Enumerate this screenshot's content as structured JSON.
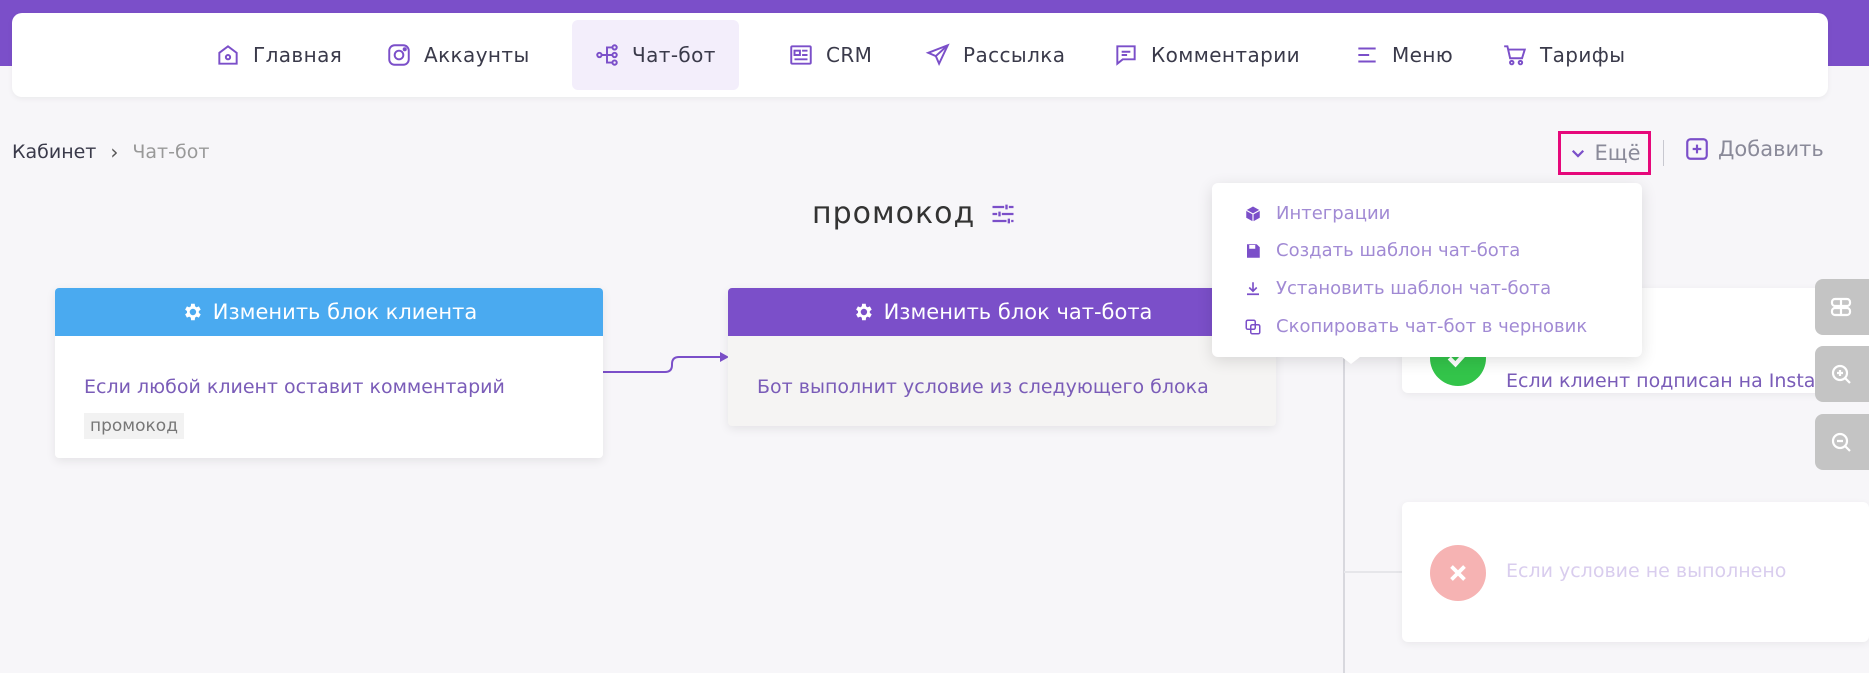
{
  "nav": {
    "items": [
      {
        "label": "Главная",
        "icon": "home-icon"
      },
      {
        "label": "Аккаунты",
        "icon": "instagram-icon"
      },
      {
        "label": "Чат-бот",
        "icon": "flow-icon"
      },
      {
        "label": "CRM",
        "icon": "crm-icon"
      },
      {
        "label": "Рассылка",
        "icon": "send-icon"
      },
      {
        "label": "Комментарии",
        "icon": "comment-icon"
      },
      {
        "label": "Меню",
        "icon": "menu-icon"
      },
      {
        "label": "Тарифы",
        "icon": "cart-icon"
      }
    ],
    "active": "Чат-бот"
  },
  "breadcrumb": {
    "root": "Кабинет",
    "current": "Чат-бот"
  },
  "toolbar": {
    "more_label": "Ещё",
    "add_label": "Добавить"
  },
  "page": {
    "title": "промокод"
  },
  "client_block": {
    "header": "Изменить блок клиента",
    "text": "Если любой клиент оставит комментарий",
    "tag": "промокод",
    "color": "#4aaaf0"
  },
  "bot_block": {
    "header": "Изменить блок чат-бота",
    "text": "Бот выполнит условие из следующего блока",
    "color": "#7b4fc9"
  },
  "conditions": {
    "yes_text": "Если клиент подписан на Instagr",
    "no_text": "Если условие не выполнено",
    "yes_color": "#33c44a",
    "no_color": "#f6b3b3"
  },
  "dropdown": {
    "items": [
      {
        "label": "Интеграции",
        "icon": "cube-icon"
      },
      {
        "label": "Создать шаблон чат-бота",
        "icon": "save-icon"
      },
      {
        "label": "Установить шаблон чат-бота",
        "icon": "download-icon"
      },
      {
        "label": "Скопировать чат-бот в черновик",
        "icon": "copy-icon"
      }
    ]
  },
  "colors": {
    "accent": "#7b4fc9",
    "highlight": "#e6087b"
  }
}
